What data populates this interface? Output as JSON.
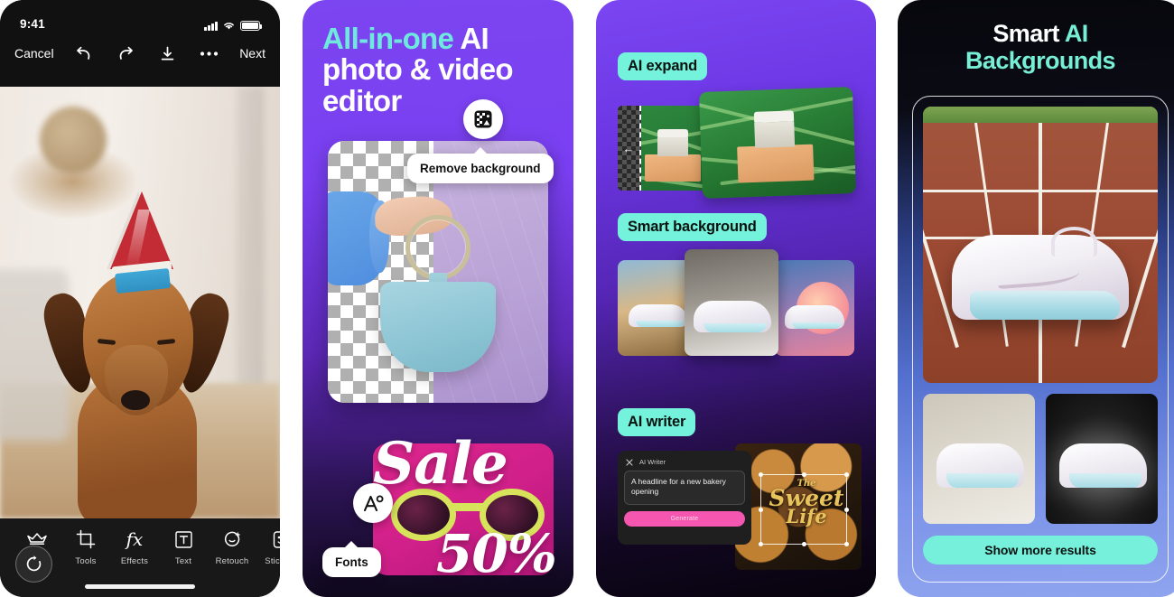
{
  "meta": {
    "accent_cyan": "#6fe9dd",
    "accent_mint": "#74f2db",
    "accent_pink": "#f556b0",
    "purple": "#7b45f0"
  },
  "panel1": {
    "name": "photo-editor-phone-screen",
    "status": {
      "time": "9:41",
      "signal_icon": "signal-bars-icon",
      "wifi_icon": "wifi-icon",
      "battery_icon": "battery-full-icon"
    },
    "topbar": {
      "cancel": "Cancel",
      "undo_icon": "undo-icon",
      "redo_icon": "redo-icon",
      "download_icon": "download-icon",
      "more_icon": "more-options-icon",
      "next": "Next"
    },
    "tools": [
      {
        "label": "Gold",
        "icon": "crown-icon"
      },
      {
        "label": "Tools",
        "icon": "crop-icon"
      },
      {
        "label": "Effects",
        "icon": "fx-icon"
      },
      {
        "label": "Text",
        "icon": "text-box-icon"
      },
      {
        "label": "Retouch",
        "icon": "face-retouch-icon"
      },
      {
        "label": "Stickers",
        "icon": "sticker-icon"
      }
    ],
    "reset_icon": "reset-rotate-icon",
    "home_indicator": "home-indicator"
  },
  "panel2": {
    "name": "all-in-one-ai-editor-promo",
    "headline_line1": "All-in-one",
    "headline_line2": "AI",
    "headline_line3": "photo & video",
    "headline_line4": "editor",
    "badge_icon": "remove-background-icon",
    "tooltip_remove_background": "Remove background",
    "fonts_icon": "font-aa-icon",
    "tooltip_fonts": "Fonts",
    "sale_word": "Sale",
    "sale_percent": "50%"
  },
  "panel3": {
    "name": "ai-features-promo",
    "sections": [
      {
        "chip": "AI expand",
        "icon_left": "arrow-left-icon",
        "icon_right": "arrow-right-icon"
      },
      {
        "chip": "Smart background"
      },
      {
        "chip": "AI writer"
      }
    ],
    "writer": {
      "close_icon": "close-icon",
      "title": "AI Writer",
      "prompt": "A headline for a new bakery opening",
      "generate_label": "Generate"
    },
    "bakery_art": {
      "line1": "The",
      "line2": "Sweet",
      "line3": "Life"
    }
  },
  "panel4": {
    "name": "smart-ai-backgrounds-promo",
    "title_word1": "Smart",
    "title_word2": "AI",
    "title_word3": "Backgrounds",
    "cta_label": "Show more results"
  }
}
